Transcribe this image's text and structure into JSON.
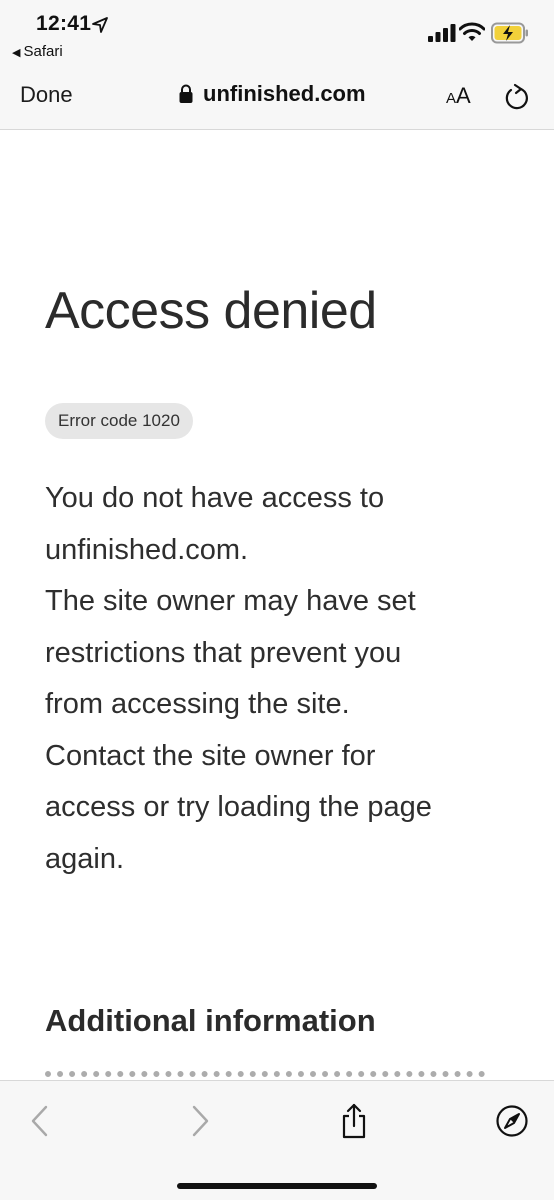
{
  "status": {
    "time": "12:41",
    "back_app": "Safari",
    "location_icon": "location-arrow-icon",
    "signal_icon": "cellular-signal-icon",
    "wifi_icon": "wifi-icon",
    "battery_icon": "battery-charging-icon"
  },
  "nav": {
    "done_label": "Done",
    "url": "unfinished.com",
    "text_size_small": "A",
    "text_size_big": "A",
    "reload_icon": "reload-icon",
    "lock_icon": "lock-icon"
  },
  "page": {
    "title": "Access denied",
    "error_badge": "Error code 1020",
    "message_lines": [
      "You do not have access to",
      "unfinished.com.",
      "The site owner may have set",
      "restrictions that prevent you",
      "from accessing the site.",
      "Contact the site owner for",
      "access or try loading the page",
      "again."
    ],
    "section_title": "Additional information"
  },
  "toolbar": {
    "back_icon": "chevron-left-icon",
    "forward_icon": "chevron-right-icon",
    "share_icon": "share-icon",
    "compass_icon": "compass-icon"
  },
  "colors": {
    "bar_background": "#f7f7f7",
    "text": "#2b2b2b",
    "badge_background": "#e6e6e6",
    "battery_fill": "#f2d13a"
  }
}
